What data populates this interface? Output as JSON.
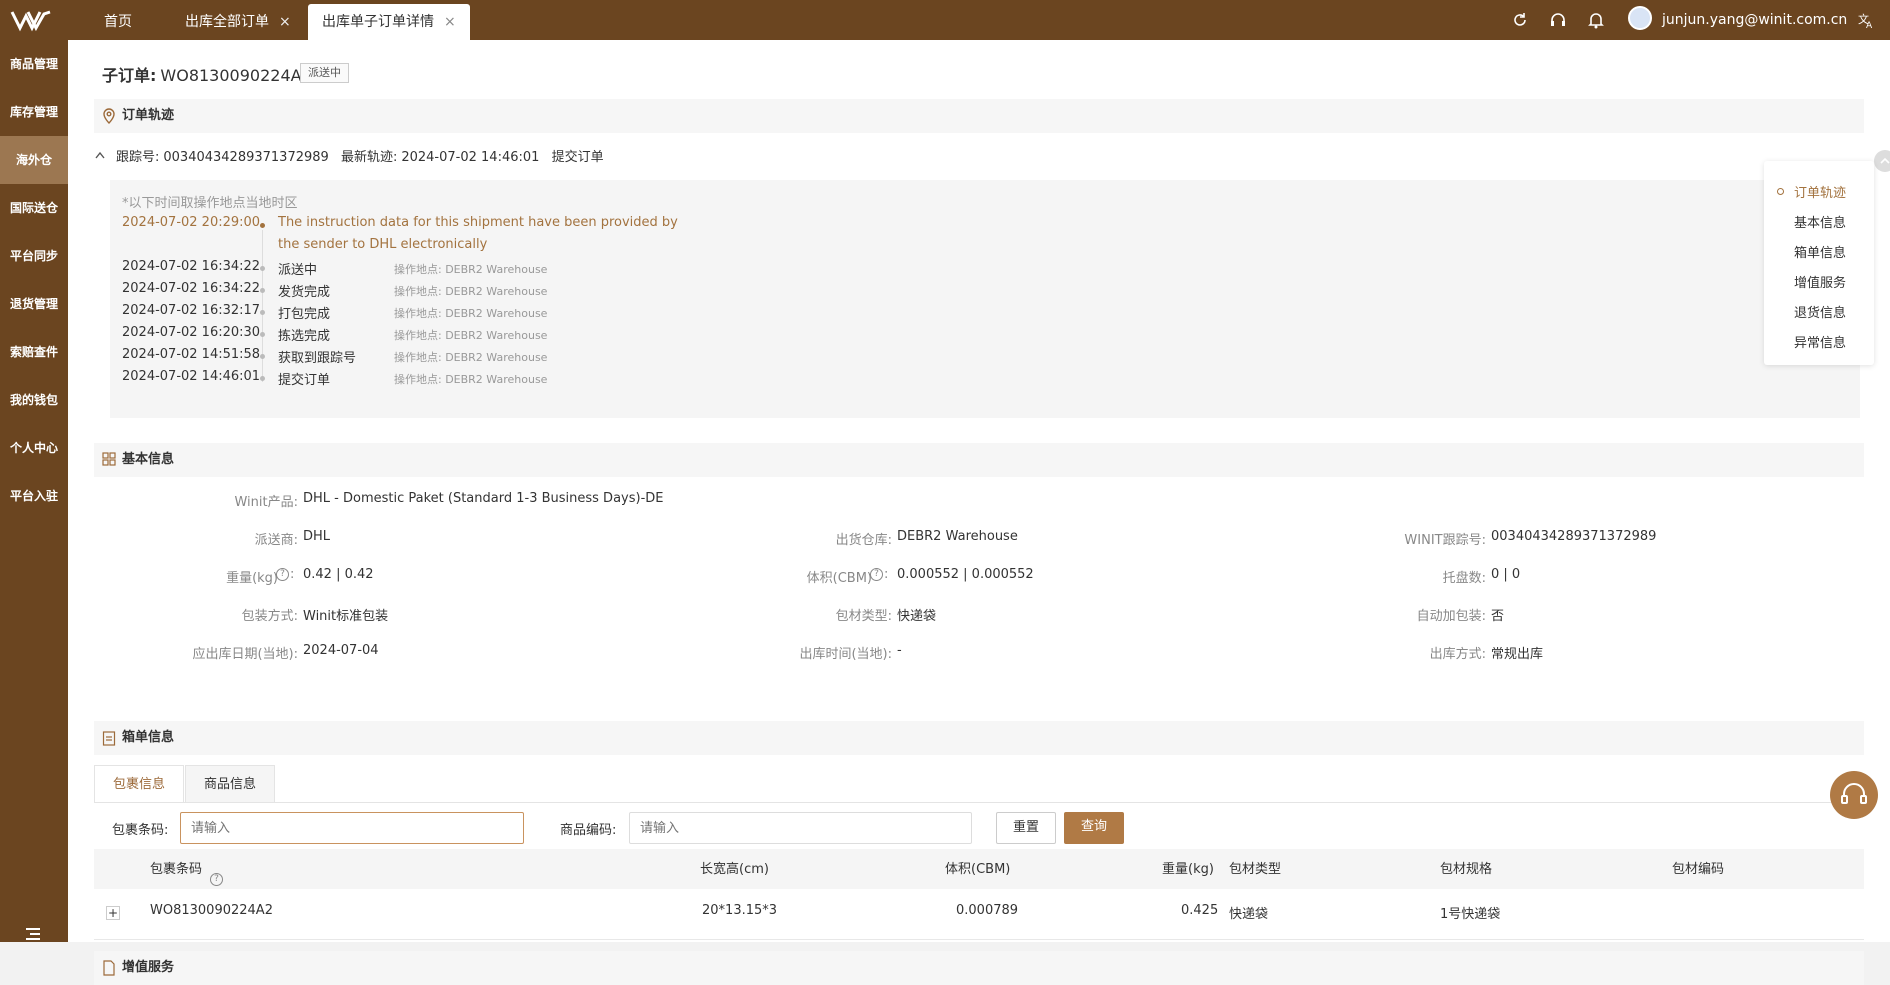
{
  "topbar": {
    "tabs": [
      {
        "label": "首页"
      },
      {
        "label": "出库全部订单"
      },
      {
        "label": "出库单子订单详情"
      }
    ],
    "user_email": "junjun.yang@winit.com.cn"
  },
  "sidebar": {
    "items": [
      {
        "label": "商品管理"
      },
      {
        "label": "库存管理"
      },
      {
        "label": "海外仓"
      },
      {
        "label": "国际送仓"
      },
      {
        "label": "平台同步"
      },
      {
        "label": "退货管理"
      },
      {
        "label": "索赔查件"
      },
      {
        "label": "我的钱包"
      },
      {
        "label": "个人中心"
      },
      {
        "label": "平台入驻"
      }
    ]
  },
  "order": {
    "title_prefix": "子订单:",
    "order_no": "WO8130090224A",
    "status": "派送中"
  },
  "tracking": {
    "section_title": "订单轨迹",
    "tracking_label": "跟踪号:",
    "tracking_no": "00340434289371372989",
    "latest_label": "最新轨迹:",
    "latest_time": "2024-07-02 14:46:01",
    "latest_event": "提交订单",
    "note": "*以下时间取操作地点当地时区",
    "events": [
      {
        "time": "2024-07-02 20:29:00",
        "text": "The instruction data for this shipment have been provided by",
        "text2": "the sender to DHL electronically",
        "loc": ""
      },
      {
        "time": "2024-07-02 16:34:22",
        "text": "派送中",
        "loc": "操作地点: DEBR2 Warehouse"
      },
      {
        "time": "2024-07-02 16:34:22",
        "text": "发货完成",
        "loc": "操作地点: DEBR2 Warehouse"
      },
      {
        "time": "2024-07-02 16:32:17",
        "text": "打包完成",
        "loc": "操作地点: DEBR2 Warehouse"
      },
      {
        "time": "2024-07-02 16:20:30",
        "text": "拣选完成",
        "loc": "操作地点: DEBR2 Warehouse"
      },
      {
        "time": "2024-07-02 14:51:58",
        "text": "获取到跟踪号",
        "loc": "操作地点: DEBR2 Warehouse"
      },
      {
        "time": "2024-07-02 14:46:01",
        "text": "提交订单",
        "loc": "操作地点: DEBR2 Warehouse"
      }
    ]
  },
  "basic": {
    "section_title": "基本信息",
    "product_label": "Winit产品:",
    "product": "DHL - Domestic Paket (Standard 1-3 Business Days)-DE",
    "carrier_label": "派送商:",
    "carrier": "DHL",
    "warehouse_label": "出货仓库:",
    "warehouse": "DEBR2 Warehouse",
    "winit_track_label": "WINIT跟踪号:",
    "winit_track": "00340434289371372989",
    "weight_label": "重量(kg)",
    "weight": "0.42 | 0.42",
    "volume_label": "体积(CBM)",
    "volume": "0.000552 | 0.000552",
    "pallet_label": "托盘数:",
    "pallet": "0 | 0",
    "pack_label": "包装方式:",
    "pack": "Winit标准包装",
    "material_label": "包材类型:",
    "material": "快递袋",
    "autopack_label": "自动加包装:",
    "autopack": "否",
    "due_label": "应出库日期(当地):",
    "due": "2024-07-04",
    "out_time_label": "出库时间(当地):",
    "out_time": "-",
    "out_mode_label": "出库方式:",
    "out_mode": "常规出库"
  },
  "box": {
    "section_title": "箱单信息",
    "tabs": [
      {
        "label": "包裹信息"
      },
      {
        "label": "商品信息"
      }
    ],
    "barcode_label": "包裹条码:",
    "barcode_placeholder": "请输入",
    "sku_label": "商品编码:",
    "sku_placeholder": "请输入",
    "reset": "重置",
    "query": "查询",
    "columns": [
      "包裹条码",
      "长宽高(cm)",
      "体积(CBM)",
      "重量(kg)",
      "包材类型",
      "包材规格",
      "包材编码"
    ],
    "rows": [
      {
        "expand": "+",
        "barcode": "WO8130090224A2",
        "dims": "20*13.15*3",
        "volume": "0.000789",
        "weight": "0.425",
        "material": "快递袋",
        "spec": "1号快递袋",
        "code": ""
      }
    ]
  },
  "vas": {
    "section_title": "增值服务"
  },
  "anchors": {
    "items": [
      {
        "label": "订单轨迹"
      },
      {
        "label": "基本信息"
      },
      {
        "label": "箱单信息"
      },
      {
        "label": "增值服务"
      },
      {
        "label": "退货信息"
      },
      {
        "label": "异常信息"
      }
    ]
  },
  "colors": {
    "brand": "#6b4520",
    "accent": "#9c6a3a",
    "sidebar_active": "#9c7751"
  }
}
